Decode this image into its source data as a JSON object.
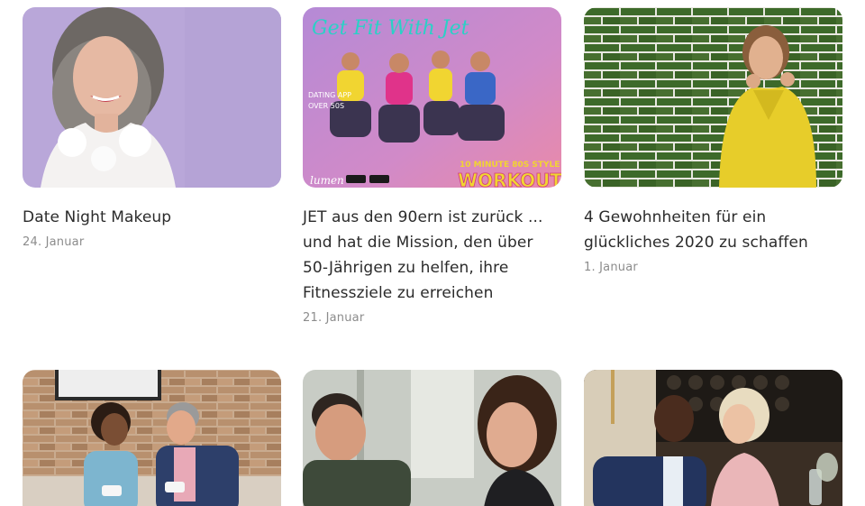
{
  "articles": [
    {
      "title": "Date Night Makeup",
      "date": "24. Januar",
      "image": "woman-grey-hair-lilac-background"
    },
    {
      "title": "JET aus den 90ern ist zurück ... und hat die Mission, den über 50-Jährigen zu helfen, ihre Fitnessziele zu erreichen",
      "date": "21. Januar",
      "image": "fitness-workout-poster",
      "poster": {
        "headline": "Get Fit With Jet",
        "brand": "lumen",
        "tag1": "DATING APP",
        "tag2": "OVER 50S",
        "badge_top": "10 MINUTE 80S STYLE",
        "badge_main": "WORKOUT"
      }
    },
    {
      "title": "4 Gewohnheiten für ein glückliches 2020 zu schaffen",
      "date": "1. Januar",
      "image": "woman-yellow-coat-green-brick-wall"
    },
    {
      "title": "",
      "date": "",
      "image": "couple-on-sofa-brick-wall"
    },
    {
      "title": "",
      "date": "",
      "image": "couple-conversation-cafe"
    },
    {
      "title": "",
      "date": "",
      "image": "couple-restaurant-wine"
    }
  ],
  "colors": {
    "title": "#2b2b2b",
    "date": "#8c8c8c",
    "lilac": "#b9a6d8",
    "brick_green": "#3f6b2a",
    "yellow": "#e9cf2a"
  }
}
